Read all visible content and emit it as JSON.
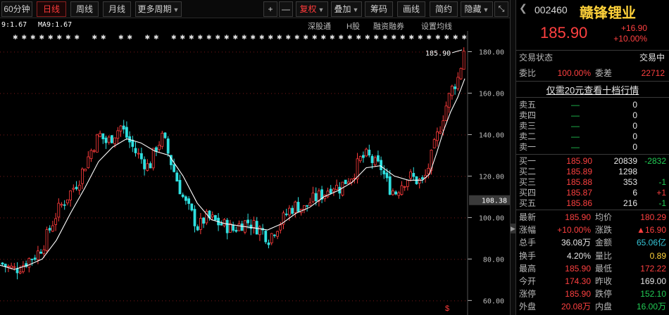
{
  "toolbar": {
    "periods": [
      "60分钟",
      "日线",
      "周线",
      "月线"
    ],
    "active_period": "日线",
    "more_periods": "更多周期",
    "plus": "+",
    "minus": "—",
    "fuquan": "复权",
    "diejia": "叠加",
    "chouma": "筹码",
    "huaxian": "画线",
    "jianyue": "简约",
    "yincang": "隐藏",
    "collapse_icon": "collapse-icon"
  },
  "ma_row": {
    "left_value": "9:1.67",
    "ma9": "MA9:1.67",
    "links": [
      "深股通",
      "H股",
      "融资融券",
      "设置均线"
    ]
  },
  "chart_data": {
    "type": "candlestick",
    "y_ticks": [
      "180.00",
      "160.00",
      "140.00",
      "120.00",
      "100.00",
      "80.00",
      "60.00"
    ],
    "ylim": [
      53,
      190
    ],
    "current_price_label": "108.38",
    "last_close_label": "185.90",
    "up_color": "#ff3b3b",
    "down_color": "#2fe0e0",
    "ma_color": "#ffffff",
    "close_path": [
      [
        0,
        78
      ],
      [
        10,
        76
      ],
      [
        20,
        75
      ],
      [
        30,
        77
      ],
      [
        40,
        80
      ],
      [
        50,
        82
      ],
      [
        60,
        87
      ],
      [
        70,
        95
      ],
      [
        80,
        103
      ],
      [
        90,
        108
      ],
      [
        100,
        113
      ],
      [
        110,
        118
      ],
      [
        120,
        126
      ],
      [
        130,
        134
      ],
      [
        140,
        140
      ],
      [
        150,
        136
      ],
      [
        160,
        140
      ],
      [
        170,
        144
      ],
      [
        180,
        138
      ],
      [
        190,
        132
      ],
      [
        200,
        128
      ],
      [
        210,
        124
      ],
      [
        220,
        134
      ],
      [
        230,
        139
      ],
      [
        240,
        128
      ],
      [
        250,
        118
      ],
      [
        260,
        108
      ],
      [
        270,
        102
      ],
      [
        280,
        95
      ],
      [
        290,
        100
      ],
      [
        300,
        99
      ],
      [
        310,
        97
      ],
      [
        320,
        96
      ],
      [
        330,
        94
      ],
      [
        340,
        97
      ],
      [
        350,
        98
      ],
      [
        360,
        96
      ],
      [
        370,
        94
      ],
      [
        380,
        90
      ],
      [
        390,
        95
      ],
      [
        400,
        99
      ],
      [
        410,
        104
      ],
      [
        420,
        106
      ],
      [
        430,
        104
      ],
      [
        440,
        108
      ],
      [
        450,
        110
      ],
      [
        460,
        112
      ],
      [
        470,
        116
      ],
      [
        480,
        114
      ],
      [
        490,
        118
      ],
      [
        500,
        121
      ],
      [
        510,
        128
      ],
      [
        520,
        130
      ],
      [
        530,
        126
      ],
      [
        540,
        124
      ],
      [
        550,
        115
      ],
      [
        560,
        112
      ],
      [
        570,
        117
      ],
      [
        580,
        120
      ],
      [
        590,
        118
      ],
      [
        600,
        117
      ],
      [
        610,
        128
      ],
      [
        620,
        140
      ],
      [
        630,
        152
      ],
      [
        640,
        162
      ],
      [
        650,
        168
      ],
      [
        660,
        186
      ]
    ],
    "ma_path": [
      [
        0,
        77
      ],
      [
        20,
        75
      ],
      [
        40,
        77
      ],
      [
        60,
        80
      ],
      [
        80,
        89
      ],
      [
        100,
        102
      ],
      [
        120,
        114
      ],
      [
        140,
        127
      ],
      [
        160,
        134
      ],
      [
        180,
        138
      ],
      [
        200,
        136
      ],
      [
        220,
        132
      ],
      [
        240,
        130
      ],
      [
        260,
        120
      ],
      [
        280,
        107
      ],
      [
        300,
        99
      ],
      [
        320,
        97
      ],
      [
        340,
        96
      ],
      [
        360,
        95
      ],
      [
        380,
        94
      ],
      [
        400,
        97
      ],
      [
        420,
        102
      ],
      [
        440,
        105
      ],
      [
        460,
        110
      ],
      [
        480,
        113
      ],
      [
        500,
        117
      ],
      [
        520,
        124
      ],
      [
        540,
        125
      ],
      [
        560,
        120
      ],
      [
        580,
        118
      ],
      [
        600,
        118
      ],
      [
        610,
        121
      ],
      [
        620,
        131
      ],
      [
        630,
        142
      ],
      [
        640,
        151
      ],
      [
        650,
        158
      ],
      [
        660,
        167
      ]
    ]
  },
  "panel": {
    "code": "002460",
    "name": "赣锋锂业",
    "price": "185.90",
    "change": "+16.90",
    "change_pct": "+10.00%",
    "status_label": "交易状态",
    "status_value": "交易中",
    "weibi_label": "委比",
    "weibi_value": "100.00%",
    "weicha_label": "委差",
    "weicha_value": "22712",
    "promo": "仅需20元查看十档行情",
    "asks": [
      {
        "label": "卖五",
        "price": "—",
        "vol": "0"
      },
      {
        "label": "卖四",
        "price": "—",
        "vol": "0"
      },
      {
        "label": "卖三",
        "price": "—",
        "vol": "0"
      },
      {
        "label": "卖二",
        "price": "—",
        "vol": "0"
      },
      {
        "label": "卖一",
        "price": "—",
        "vol": "0"
      }
    ],
    "bids": [
      {
        "label": "买一",
        "price": "185.90",
        "vol": "20839",
        "delta": "-2832"
      },
      {
        "label": "买二",
        "price": "185.89",
        "vol": "1298",
        "delta": ""
      },
      {
        "label": "买三",
        "price": "185.88",
        "vol": "353",
        "delta": "-1"
      },
      {
        "label": "买四",
        "price": "185.87",
        "vol": "6",
        "delta": "+1"
      },
      {
        "label": "买五",
        "price": "185.86",
        "vol": "216",
        "delta": "-1"
      }
    ],
    "stats": [
      {
        "l1": "最新",
        "v1": "185.90",
        "l2": "均价",
        "v2": "180.29"
      },
      {
        "l1": "涨幅",
        "v1": "+10.00%",
        "l2": "涨跌",
        "v2": "▲16.90"
      },
      {
        "l1": "总手",
        "v1": "36.08万",
        "l2": "金额",
        "v2": "65.06亿"
      },
      {
        "l1": "换手",
        "v1": "4.20%",
        "l2": "量比",
        "v2": "0.89"
      },
      {
        "l1": "最高",
        "v1": "185.90",
        "l2": "最低",
        "v2": "172.22"
      },
      {
        "l1": "今开",
        "v1": "174.30",
        "l2": "昨收",
        "v2": "169.00"
      },
      {
        "l1": "涨停",
        "v1": "185.90",
        "l2": "跌停",
        "v2": "152.10"
      },
      {
        "l1": "外盘",
        "v1": "20.08万",
        "l2": "内盘",
        "v2": "16.00万"
      }
    ]
  }
}
